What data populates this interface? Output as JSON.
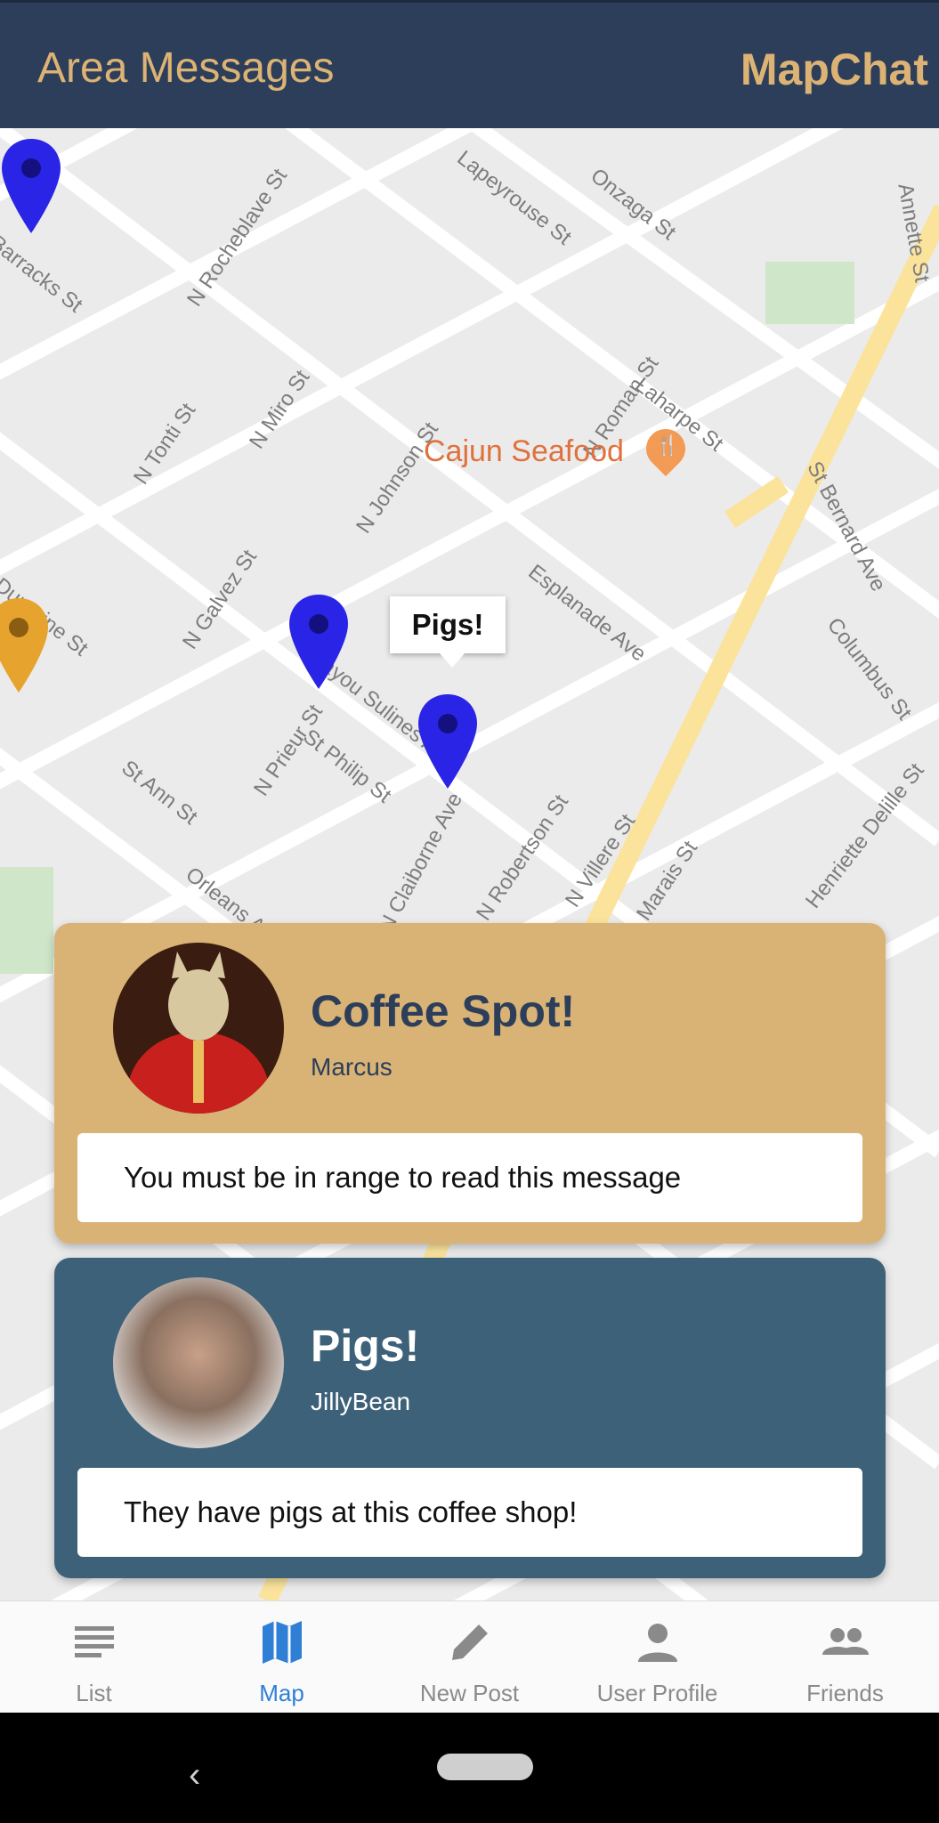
{
  "header": {
    "title": "Area Messages",
    "brand": "MapChat"
  },
  "map": {
    "poi": "Cajun Seafood",
    "callout": "Pigs!",
    "streets": [
      "Barracks St",
      "N Rocheblave St",
      "Lapeyrouse St",
      "Onzaga St",
      "Annette St",
      "N Tonti St",
      "N Miro St",
      "N Johnson St",
      "N Roman St",
      "Laharpe St",
      "St Bernard Ave",
      "Dumaine St",
      "N Galvez St",
      "Esplanade Ave",
      "Columbus St",
      "Bayou Sulines Ave",
      "St Philip St",
      "N Prieur St",
      "St Ann St",
      "Henriette Delille St",
      "N Claiborne Ave",
      "N Robertson St",
      "N Villere St",
      "Marais St",
      "Orleans Ave"
    ]
  },
  "cards": [
    {
      "title": "Coffee Spot!",
      "user": "Marcus",
      "message": "You must be in range to read this message"
    },
    {
      "title": "Pigs!",
      "user": "JillyBean",
      "message": "They have pigs at this coffee shop!"
    }
  ],
  "tabs": [
    {
      "label": "List",
      "icon": "list-icon",
      "active": false
    },
    {
      "label": "Map",
      "icon": "map-icon",
      "active": true
    },
    {
      "label": "New Post",
      "icon": "pencil-icon",
      "active": false
    },
    {
      "label": "User Profile",
      "icon": "person-icon",
      "active": false
    },
    {
      "label": "Friends",
      "icon": "people-icon",
      "active": false
    }
  ],
  "colors": {
    "header": "#2c3e5a",
    "accent": "#dcb374",
    "card_gold": "#d9b376",
    "card_blue": "#3c6178",
    "pin_blue": "#2a24e6",
    "pin_gold": "#e6a42e",
    "active_tab": "#2f7fd6"
  }
}
